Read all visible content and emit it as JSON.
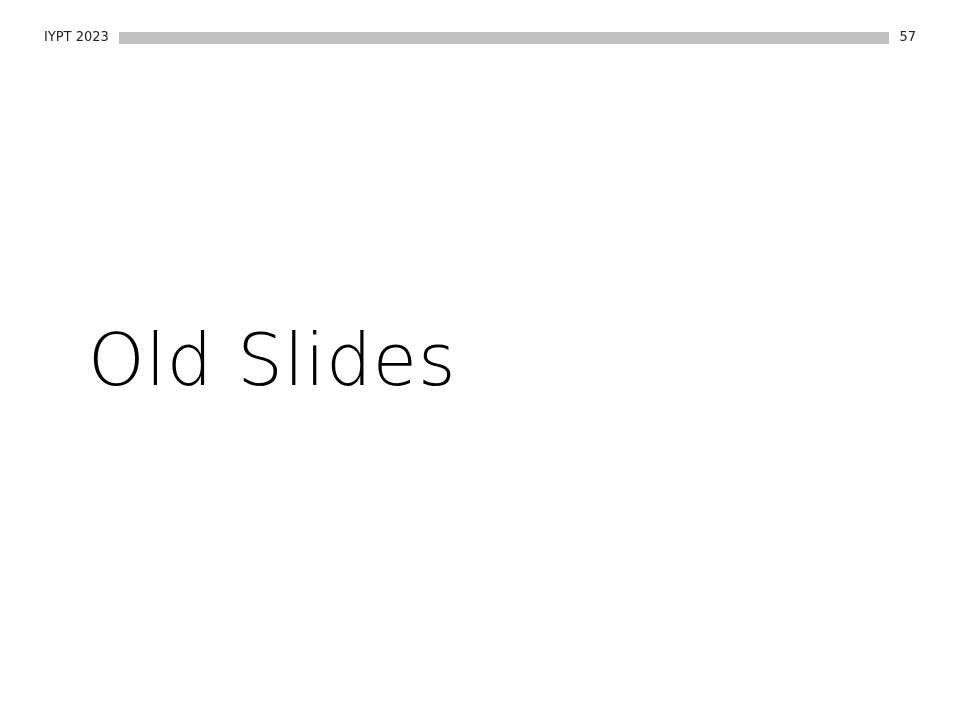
{
  "header": {
    "event_label": "IYPT 2023",
    "page_number": "57",
    "bar_color": "#bfbfbf"
  },
  "main": {
    "title": "Old Slides"
  }
}
